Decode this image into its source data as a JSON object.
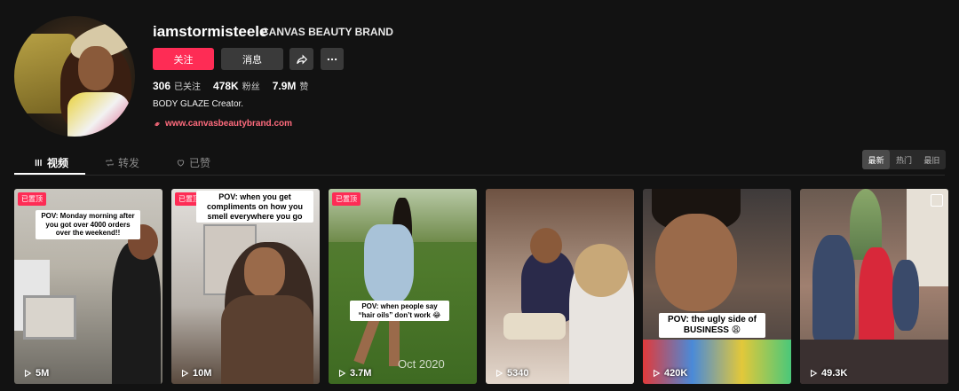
{
  "profile": {
    "username": "iamstormisteele",
    "brand_name": "CANVAS BEAUTY BRAND",
    "follow_label": "关注",
    "message_label": "消息",
    "share_icon": "share-icon",
    "more_icon": "more-icon",
    "stats": {
      "following_count": "306",
      "following_label": "已关注",
      "followers_count": "478K",
      "followers_label": "粉丝",
      "likes_count": "7.9M",
      "likes_label": "赞"
    },
    "bio": "BODY GLAZE Creator.",
    "link": "www.canvasbeautybrand.com",
    "accent": "#fe2c55"
  },
  "tabs": [
    {
      "label": "视频",
      "icon": "grid-icon"
    },
    {
      "label": "转发",
      "icon": "repost-icon"
    },
    {
      "label": "已赞",
      "icon": "heart-icon"
    }
  ],
  "sort": {
    "latest": "最新",
    "popular": "热门",
    "oldest": "最旧"
  },
  "videos": [
    {
      "badge": "已置顶",
      "caption": "POV: Monday morning after you got over 4000 orders over the weekend!!",
      "views": "5M"
    },
    {
      "badge": "已置顶",
      "caption": "POV: when you get compliments on how you smell everywhere you go",
      "views": "10M"
    },
    {
      "badge": "已置顶",
      "caption": "POV: when people say “hair oils” don’t work 😂",
      "watermark": "Oct 2020",
      "views": "3.7M"
    },
    {
      "badge": "",
      "caption": "",
      "views": "5340"
    },
    {
      "badge": "",
      "caption": "POV: the ugly side of BUSINESS 😩",
      "views": "420K"
    },
    {
      "badge": "",
      "caption": "",
      "views": "49.3K"
    }
  ]
}
